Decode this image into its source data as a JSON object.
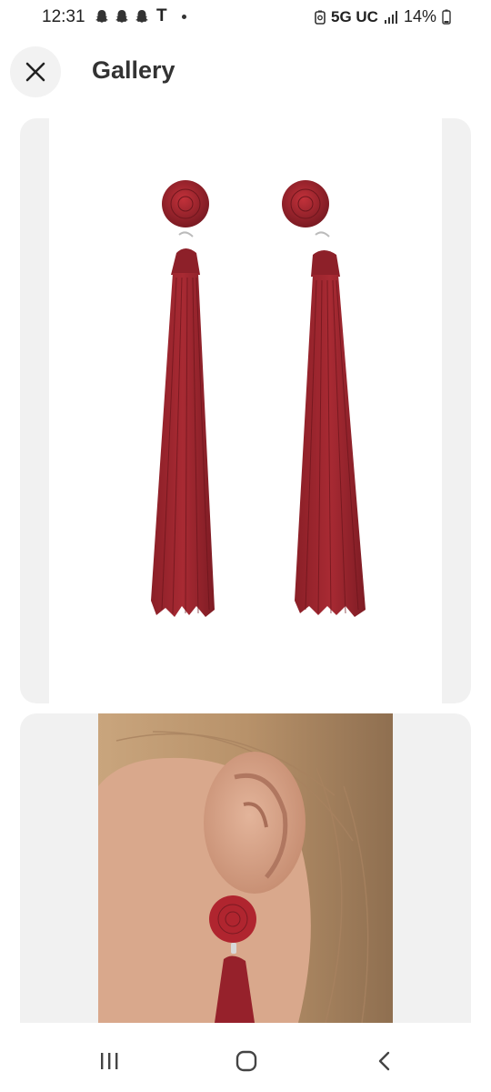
{
  "status_bar": {
    "time": "12:31",
    "carrier_letter": "T",
    "network": "5G UC",
    "battery": "14%"
  },
  "header": {
    "title": "Gallery",
    "close_icon": "close-icon"
  },
  "gallery": {
    "images": [
      {
        "kind": "product-photo",
        "subject": "red tassel earrings pair"
      },
      {
        "kind": "model-photo",
        "subject": "red tassel earring worn on ear"
      }
    ]
  },
  "nav_bar": {
    "icons": [
      "recent-apps-icon",
      "home-icon",
      "back-icon"
    ]
  },
  "colors": {
    "accent_red": "#9e2530",
    "card_bg": "#f1f1f1",
    "text": "#333333"
  }
}
